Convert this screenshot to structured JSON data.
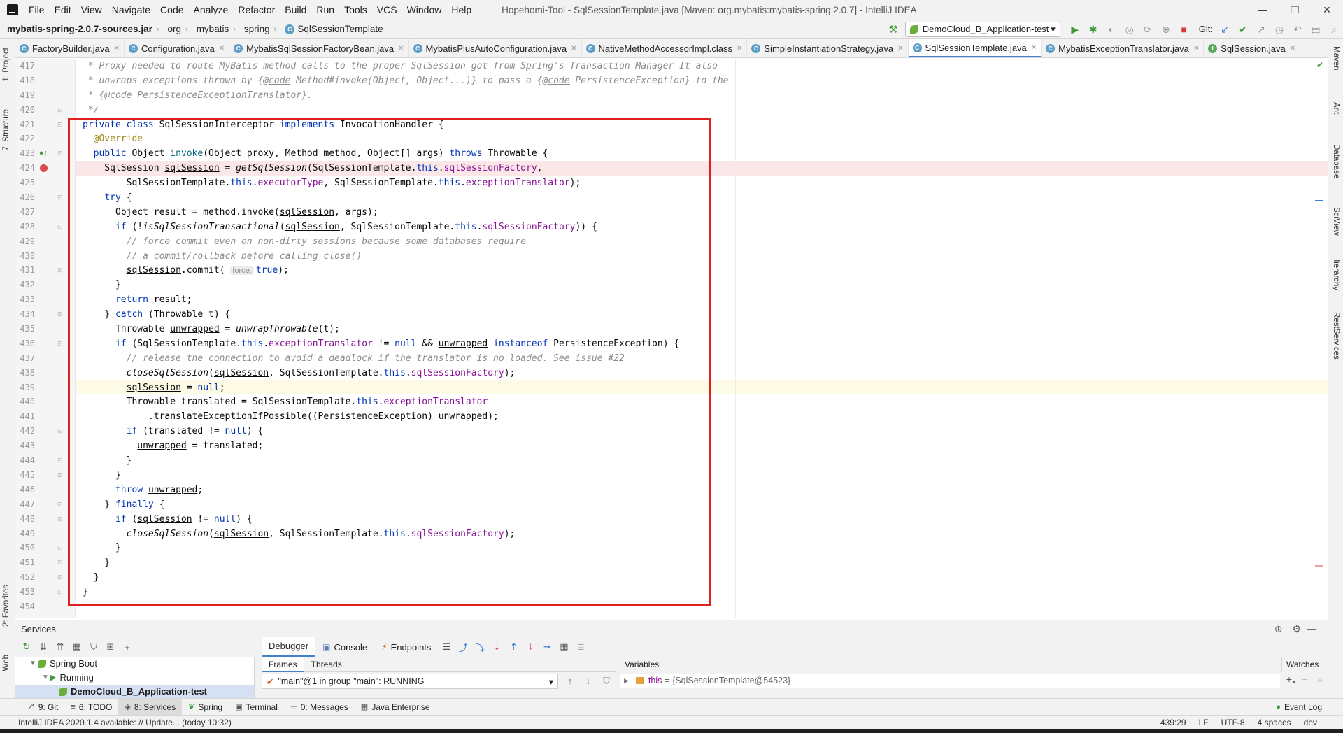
{
  "window": {
    "title": "Hopehomi-Tool - SqlSessionTemplate.java [Maven: org.mybatis:mybatis-spring:2.0.7] - IntelliJ IDEA",
    "minimize": "—",
    "maximize": "❐",
    "close": "✕"
  },
  "menu": [
    "File",
    "Edit",
    "View",
    "Navigate",
    "Code",
    "Analyze",
    "Refactor",
    "Build",
    "Run",
    "Tools",
    "VCS",
    "Window",
    "Help"
  ],
  "breadcrumbs": {
    "jar": "mybatis-spring-2.0.7-sources.jar",
    "pkg1": "org",
    "pkg2": "mybatis",
    "pkg3": "spring",
    "cls": "SqlSessionTemplate"
  },
  "run_config": {
    "label": "DemoCloud_B_Application-test",
    "git_label": "Git:"
  },
  "tabs": [
    {
      "label": "FactoryBuilder.java",
      "icon": "C",
      "kind": "class"
    },
    {
      "label": "Configuration.java",
      "icon": "C",
      "kind": "class"
    },
    {
      "label": "MybatisSqlSessionFactoryBean.java",
      "icon": "C",
      "kind": "class"
    },
    {
      "label": "MybatisPlusAutoConfiguration.java",
      "icon": "C",
      "kind": "class"
    },
    {
      "label": "NativeMethodAccessorImpl.class",
      "icon": "C",
      "kind": "class"
    },
    {
      "label": "SimpleInstantiationStrategy.java",
      "icon": "C",
      "kind": "class"
    },
    {
      "label": "SqlSessionTemplate.java",
      "icon": "C",
      "kind": "class",
      "active": true
    },
    {
      "label": "MybatisExceptionTranslator.java",
      "icon": "C",
      "kind": "class"
    },
    {
      "label": "SqlSession.java",
      "icon": "I",
      "kind": "interface"
    }
  ],
  "left_tool_tabs": {
    "project": "1: Project",
    "structure": "7: Structure",
    "favorites": "2: Favorites",
    "web": "Web"
  },
  "right_tool_tabs": {
    "maven": "Maven",
    "ant": "Ant",
    "database": "Database",
    "sciview": "SciView",
    "hierarchy": "Hierarchy",
    "restservices": "RestServices"
  },
  "editor": {
    "line_numbers": [
      "417",
      "418",
      "419",
      "420",
      "421",
      "422",
      "423",
      "424",
      "425",
      "426",
      "427",
      "428",
      "429",
      "430",
      "431",
      "432",
      "433",
      "434",
      "435",
      "436",
      "437",
      "438",
      "439",
      "440",
      "441",
      "442",
      "443",
      "444",
      "445",
      "446",
      "447",
      "448",
      "449",
      "450",
      "451",
      "452",
      "453",
      "454"
    ],
    "hint_force": "force:",
    "breakpoint_line": "424",
    "caret_line": "439"
  },
  "services": {
    "title": "Services",
    "tree": {
      "root": "Spring Boot",
      "group": "Running",
      "app": "DemoCloud_B_Application-test"
    },
    "debug_tabs": {
      "debugger": "Debugger",
      "console": "Console",
      "endpoints": "Endpoints"
    },
    "frames_tab": "Frames",
    "threads_tab": "Threads",
    "thread_select": "\"main\"@1 in group \"main\": RUNNING",
    "variables_header": "Variables",
    "watches_header": "Watches",
    "var_name": "this",
    "var_value": "= {SqlSessionTemplate@54523}"
  },
  "bottom_tools": [
    {
      "label": "9: Git",
      "icon": "⎇"
    },
    {
      "label": "6: TODO",
      "icon": "≡"
    },
    {
      "label": "8: Services",
      "icon": "◈",
      "active": true
    },
    {
      "label": "Spring",
      "icon": "❦"
    },
    {
      "label": "Terminal",
      "icon": "▣"
    },
    {
      "label": "0: Messages",
      "icon": "☰"
    },
    {
      "label": "Java Enterprise",
      "icon": "▦"
    }
  ],
  "event_log": "Event Log",
  "status": {
    "message": "IntelliJ IDEA 2020.1.4 available: // Update... (today 10:32)",
    "position": "439:29",
    "line_sep": "LF",
    "encoding": "UTF-8",
    "indent": "4 spaces",
    "git_branch": "dev"
  },
  "colors": {
    "keyword": "#0033b3",
    "field": "#871094",
    "annotation": "#9e880d",
    "comment": "#8c8c8c",
    "breakpoint": "#d94a4a",
    "highlight_box": "#e02020",
    "accent": "#4083c9"
  }
}
